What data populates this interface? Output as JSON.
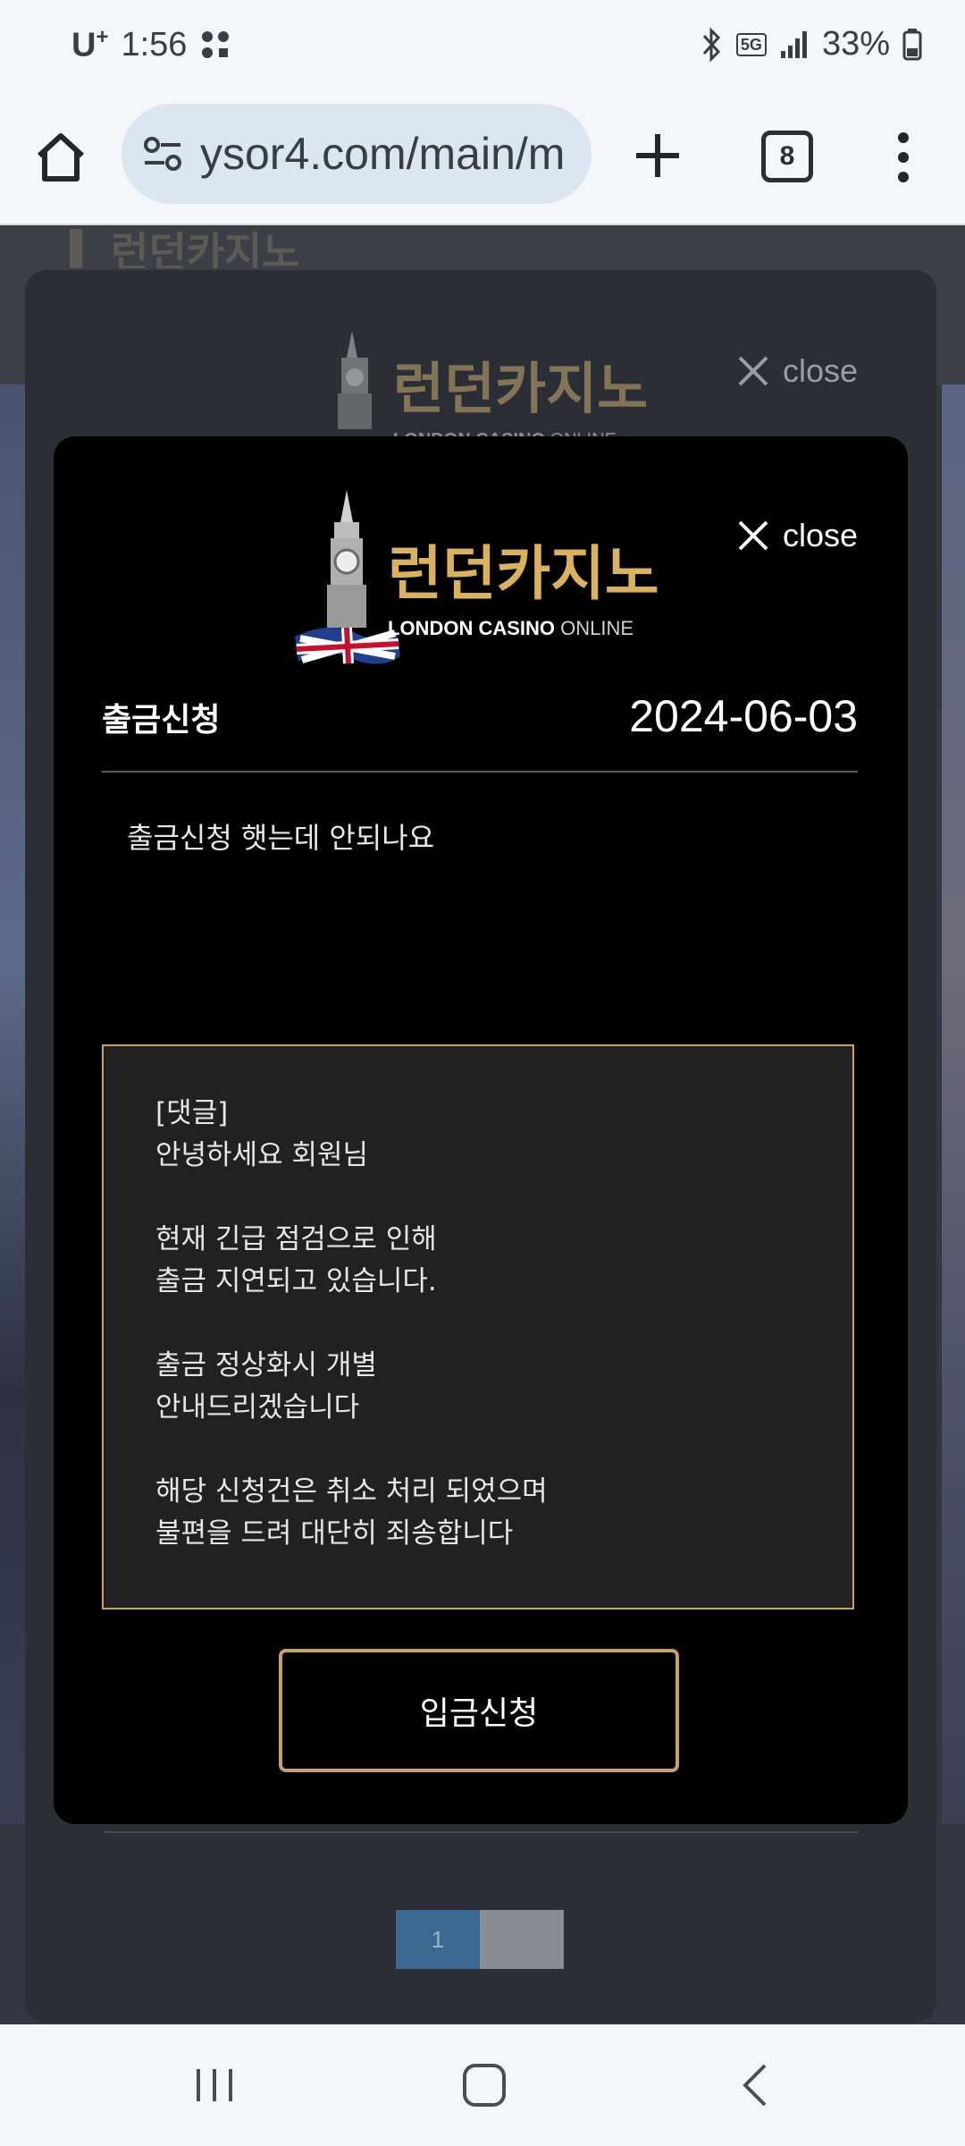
{
  "status_bar": {
    "carrier": "U",
    "carrier_sup": "+",
    "time": "1:56",
    "network": "5G",
    "battery": "33%"
  },
  "browser": {
    "url": "ysor4.com/main/m",
    "tab_count": "8"
  },
  "brand": {
    "korean_name": "런던카지노",
    "english_name_bold": "LONDON CASINO",
    "english_name_light": " ONLINE",
    "gold_color": "#c9a06a"
  },
  "outer_modal": {
    "close_label": "close",
    "pagination": {
      "current": "1"
    }
  },
  "inner_modal": {
    "close_label": "close",
    "post_title": "출금신청",
    "post_date": "2024-06-03",
    "post_body": "출금신청 햇는데 안되나요",
    "reply_lines": [
      "[댓글]",
      "안녕하세요 회원님",
      "",
      "현재 긴급 점검으로 인해",
      "출금 지연되고 있습니다.",
      "",
      "출금 정상화시 개별",
      "안내드리겠습니다",
      "",
      "해당 신청건은 취소 처리 되었으며",
      "불편을 드려 대단히 죄송합니다"
    ],
    "deposit_button_label": "입금신청"
  }
}
